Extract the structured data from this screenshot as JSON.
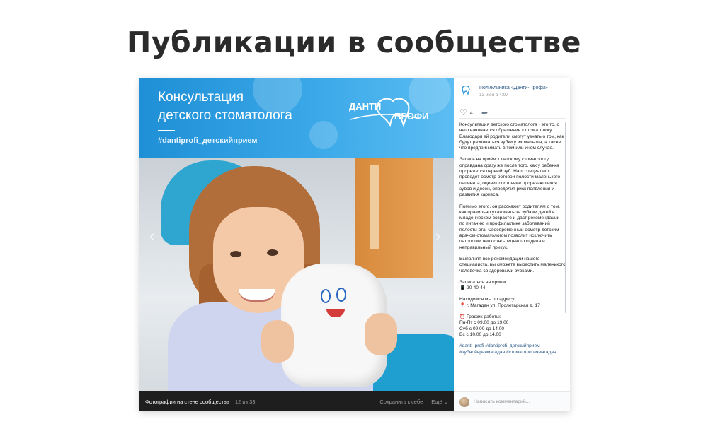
{
  "page": {
    "title": "Публикации в сообществе"
  },
  "banner": {
    "title_line1": "Консультация",
    "title_line2": "детского стоматолога",
    "hashtag": "#dantiprofi_детскийприем",
    "brand_left": "ДАНТИ",
    "brand_right": "ПРОФИ"
  },
  "footer": {
    "label": "Фотографии на стене сообщества",
    "counter": "12 из 33",
    "save": "Сохранить к себе",
    "more": "Ещё ⌄"
  },
  "post": {
    "community": "Поликлиника «Данти-Профи»",
    "date": "13 июн в 4:07",
    "likes": "4",
    "p1": "Консультация детского стоматолога - это то, с чего начинается обращение к стоматологу. Благодаря ей родители смогут узнать о том, как будут развиваться зубки у их малыша, а также что предпринимать в том или ином случае.",
    "p2": "Запись на приём к детскому стоматологу оправдана сразу же после того, как у ребенка прорежется первый зуб. Наш специалист проведёт осмотр ротовой полости маленького пациента, оценит состояние прорезающихся зубов и дёсен, определит риск появления и развития кариеса.",
    "p3": "Помимо этого, он расскажет родителям о том, как правильно ухаживать за зубами детей в младенческом возрасте и даст рекомендации по питанию и профилактике заболеваний полости рта. Своевременный осмотр детским врачом-стоматологом позволит исключить патологии челюстно-лицевого отдела и неправильный прикус.",
    "p4": "Выполняя все рекомендации нашего специалиста, вы сможете вырастить маленького человечка со здоровыми зубками.",
    "booking_label": "Записаться на прием:",
    "phone": "📱 20-40-44",
    "address_label": "Находимся мы по адресу:",
    "address": "📍 г. Магадан ул. Пролетарская д. 17",
    "schedule_label": "⏰ График работы:",
    "schedule_1": "Пн-Пт с 09.00 до 19.00",
    "schedule_2": "Суб с 09.00 до 14.00",
    "schedule_3": "Вс с 10.00 до 14.00",
    "tags_1": "#danti_profi #dantiprofi_детскийприем",
    "tags_2": "#зубнойврачмагадан #стоматологиямагадан"
  },
  "comment": {
    "placeholder": "Написать комментарий..."
  },
  "icons": {
    "like": "heart-icon",
    "share": "share-arrow-icon",
    "prev": "chevron-left-icon",
    "next": "chevron-right-icon"
  },
  "colors": {
    "banner_blue": "#2b9be0",
    "link": "#2a5885",
    "footer_bg": "#1e1e1e"
  }
}
